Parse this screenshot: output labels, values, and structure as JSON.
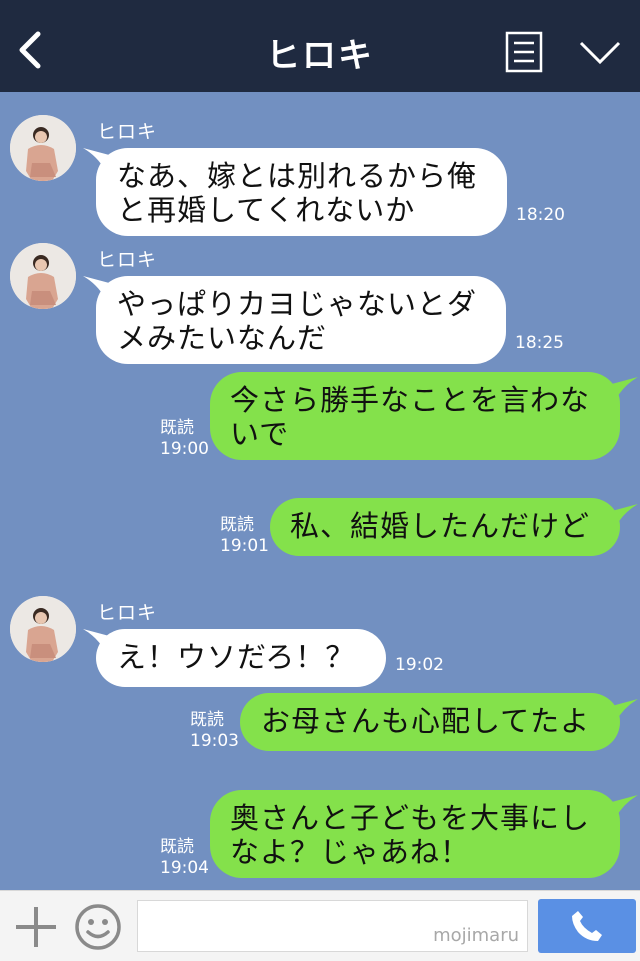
{
  "header": {
    "title": "ヒロキ",
    "back_icon": "chevron-left-icon",
    "menu_icon": "menu-icon",
    "collapse_icon": "chevron-down-icon"
  },
  "messages": [
    {
      "sender": "ヒロキ",
      "text_lines": [
        "なあ、嫁とは別れるから俺",
        "と再婚してくれないか"
      ],
      "time": "18:20"
    },
    {
      "sender": "ヒロキ",
      "text_lines": [
        "やっぱりカヨじゃないとダ",
        "メみたいなんだ"
      ],
      "time": "18:25"
    },
    {
      "read": "既読",
      "text_lines": [
        "今さら勝手なことを言わな",
        "いで"
      ],
      "time": "19:00"
    },
    {
      "read": "既読",
      "text_lines": [
        "私、結婚したんだけど"
      ],
      "time": "19:01"
    },
    {
      "sender": "ヒロキ",
      "text_lines": [
        "え！ウソだろ！？"
      ],
      "time": "19:02"
    },
    {
      "read": "既読",
      "text_lines": [
        "お母さんも心配してたよ"
      ],
      "time": "19:03"
    },
    {
      "read": "既読",
      "text_lines": [
        "奥さんと子どもを大事にし",
        "なよ？じゃあね！"
      ],
      "time": "19:04"
    }
  ],
  "input": {
    "watermark": "mojimaru"
  },
  "colors": {
    "header_bg": "#1f2a40",
    "chat_bg": "#7290c1",
    "incoming_bubble": "#ffffff",
    "outgoing_bubble": "#84e14b",
    "call_button": "#5a90e4"
  }
}
